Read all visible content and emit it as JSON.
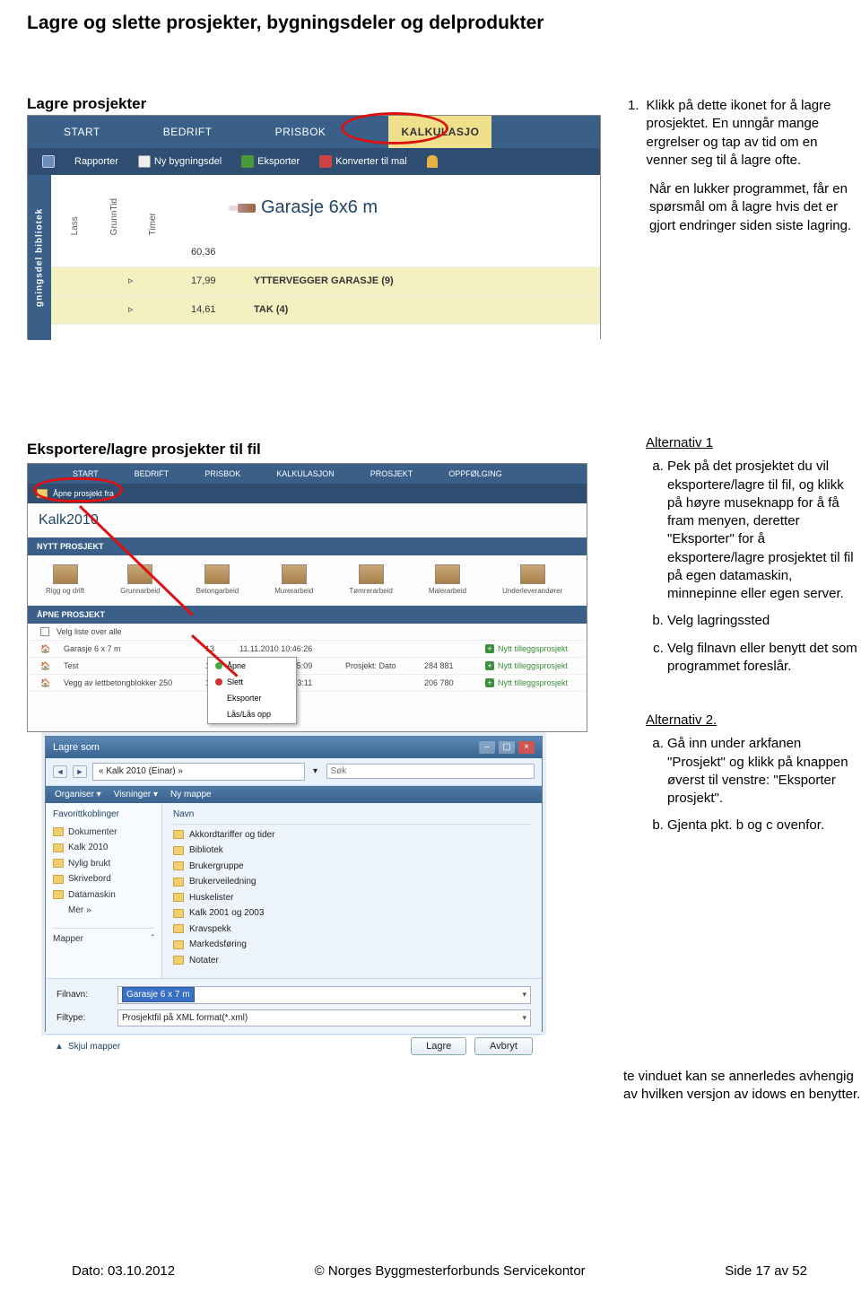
{
  "page": {
    "title": "Lagre og slette prosjekter, bygningsdeler og delprodukter"
  },
  "section1": {
    "title": "Lagre prosjekter",
    "right": {
      "intro_num": "1.",
      "intro": "Klikk på dette ikonet for å lagre prosjektet. En unngår mange ergrelser og tap av tid om en venner seg til å lagre ofte.",
      "para2": "Når en lukker programmet, får en spørsmål om å lagre hvis det er gjort endringer siden siste lagring."
    },
    "shot": {
      "tabs": {
        "start": "START",
        "bedrift": "BEDRIFT",
        "prisbok": "PRISBOK",
        "kalkulasjon": "KALKULASJO"
      },
      "toolbar": {
        "rapporter": "Rapporter",
        "nybyg": "Ny bygningsdel",
        "eksporter": "Eksporter",
        "konverter": "Konverter til mal"
      },
      "sidebar": "gningsdel bibliotek",
      "cols": {
        "lass": "Lass",
        "grunntid": "GrunnTid",
        "timer": "Timer"
      },
      "project": "Garasje 6x6 m",
      "val1": "60,36",
      "row2_val": "17,99",
      "row2_label": "YTTERVEGGER GARASJE (9)",
      "row3_val": "14,61",
      "row3_label": "TAK (4)"
    }
  },
  "section2": {
    "title": "Eksportere/lagre prosjekter til fil",
    "alt1_hdr": "Alternativ 1",
    "alt1": {
      "a": "Pek på det prosjektet du vil eksportere/lagre til fil, og klikk på høyre museknapp for å få fram menyen, deretter \"Eksporter\" for å eksportere/lagre prosjektet til fil på egen datamaskin, minnepinne eller egen server.",
      "b": "Velg lagringssted",
      "c": "Velg filnavn eller benytt det som programmet foreslår."
    },
    "alt2_hdr": "Alternativ 2.",
    "alt2": {
      "a": "Gå inn under arkfanen \"Prosjekt\" og klikk på knappen øverst til venstre: \"Eksporter prosjekt\".",
      "b": "Gjenta pkt. b og c ovenfor."
    },
    "note": "te vinduet kan se annerledes avhengig av hvilken versjon av idows en benytter.",
    "shot2": {
      "tabs": {
        "start": "START",
        "bedrift": "BEDRIFT",
        "prisbok": "PRISBOK",
        "kalkulasjon": "KALKULASJON",
        "prosjekt": "PROSJEKT",
        "oppfolging": "OPPFØLGING"
      },
      "apne": "Åpne prosjekt fra",
      "kalk": "Kalk2010",
      "hdr_new": "NYTT PROSJEKT",
      "icons": [
        "Rigg og drift",
        "Grunnarbeid",
        "Betongarbeid",
        "Murerarbeid",
        "Tømrerarbeid",
        "Malerarbeid",
        "Underleverandører"
      ],
      "hdr_open": "ÅPNE PROSJEKT",
      "velg": "Velg liste over alle",
      "nytt": "Nytt tilleggsprosjekt",
      "rows": [
        {
          "name": "Garasje 6 x 7 m",
          "c2": "13",
          "c3": "",
          "c4": "",
          "c5": ""
        },
        {
          "name": "",
          "c2": "",
          "c3": "11.11.2010 10:46:26",
          "c4": "",
          "c5": ""
        },
        {
          "name": "Test",
          "c2": "12",
          "c3": "",
          "c4": "",
          "c5": "284 881"
        },
        {
          "name": "",
          "c2": "",
          "c3": "11.11.2010 07:45:09",
          "c4": "Prosjekt: Dato",
          "c5": "284 881"
        },
        {
          "name": "Vegg av lettbetongblokker 250",
          "c2": "10",
          "c3": "",
          "c4": "",
          "c5": "206 780"
        },
        {
          "name": "",
          "c2": "",
          "c3": "03.11.2010 15:13:11",
          "c4": "",
          "c5": "206 780"
        }
      ],
      "ctx": {
        "apne": "Åpne",
        "slett": "Slett",
        "eksporter": "Eksporter",
        "las": "Lås/Lås opp"
      }
    },
    "shot3": {
      "title": "Lagre som",
      "crumb": "« Kalk 2010 (Einar) »",
      "search_ph": "Søk",
      "organiser": "Organiser ▾",
      "visninger": "Visninger ▾",
      "nymappe": "Ny mappe",
      "fav_hdr": "Favorittkoblinger",
      "favs": [
        "Dokumenter",
        "Kalk 2010",
        "Nylig brukt",
        "Skrivebord",
        "Datamaskin",
        "Mer »"
      ],
      "mapper": "Mapper",
      "col_navn": "Navn",
      "files": [
        "Akkordtariffer og tider",
        "Bibliotek",
        "Brukergruppe",
        "Brukerveiledning",
        "Huskelister",
        "Kalk 2001 og 2003",
        "Kravspekk",
        "Markedsføring",
        "Notater"
      ],
      "filnavn_lbl": "Filnavn:",
      "filnavn_val": "Garasje 6 x 7 m",
      "filtype_lbl": "Filtype:",
      "filtype_val": "Prosjektfil på XML format(*.xml)",
      "skjul": "Skjul mapper",
      "lagre": "Lagre",
      "avbryt": "Avbryt"
    }
  },
  "footer": {
    "dato": "Dato: 03.10.2012",
    "copy": "© Norges Byggmesterforbunds Servicekontor",
    "side": "Side 17 av 52"
  }
}
